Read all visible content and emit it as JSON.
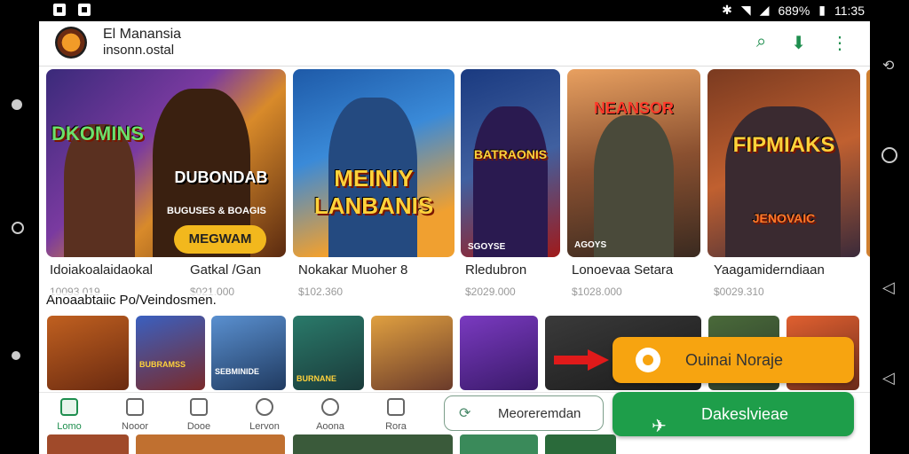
{
  "status_bar": {
    "battery_text": "​",
    "time": "11:35",
    "indicator": "689%"
  },
  "app_bar": {
    "title": "El Manansia",
    "subtitle": "insonn.ostal",
    "icons": [
      "search-icon",
      "download-icon",
      "more-vert-icon"
    ]
  },
  "featured": {
    "cards": [
      {
        "art_title": "DKOMINS",
        "name": "Idoiakoalaidaokal",
        "price": "10093 019"
      },
      {
        "art_title": "DUBONDAB",
        "badge": "MEGWAM",
        "caption": "BUGUSES & BOAGIS",
        "name": "Gatkal /Gan",
        "price": "$021.000"
      },
      {
        "art_title": "MEINIY LANBANIS",
        "name": "Nokakar Muoher 8",
        "price": "$102.360"
      },
      {
        "art_title": "BATRAONIS",
        "caption": "SGOYSE",
        "name": "Rledubron",
        "price": "$2029.000"
      },
      {
        "art_title": "NEANSOR",
        "caption": "AGOYS",
        "name": "Lonoevaa Setara",
        "price": "$1028.000"
      },
      {
        "art_title": "FIPMIAKS",
        "caption": "JENOVAIC",
        "name": "Yaagamiderndiaan",
        "price": "$0029.310"
      }
    ]
  },
  "section": {
    "title": "Anoaabtaiic Po/Veindosmen."
  },
  "grid_row": {
    "labels": [
      "",
      "BUBRAMSS",
      "SEBMINIDE",
      "BURNANE",
      "",
      "",
      "",
      ""
    ]
  },
  "floating": {
    "orange_button": "Ouinai Noraje",
    "green_button": "Dakeslvieae",
    "more_pill": "Meoreremdan"
  },
  "bottom_nav": {
    "items": [
      {
        "label": "Lomo",
        "icon": "home-icon"
      },
      {
        "label": "Nooor",
        "icon": "news-icon"
      },
      {
        "label": "Dooe",
        "icon": "list-icon"
      },
      {
        "label": "Lervon",
        "icon": "search-icon"
      },
      {
        "label": "Aoona",
        "icon": "chat-icon"
      },
      {
        "label": "Rora",
        "icon": "flag-icon"
      }
    ]
  },
  "colors": {
    "accent_green": "#1e8e4e",
    "orange": "#f7a410",
    "twitter_green": "#1e9e4a"
  }
}
